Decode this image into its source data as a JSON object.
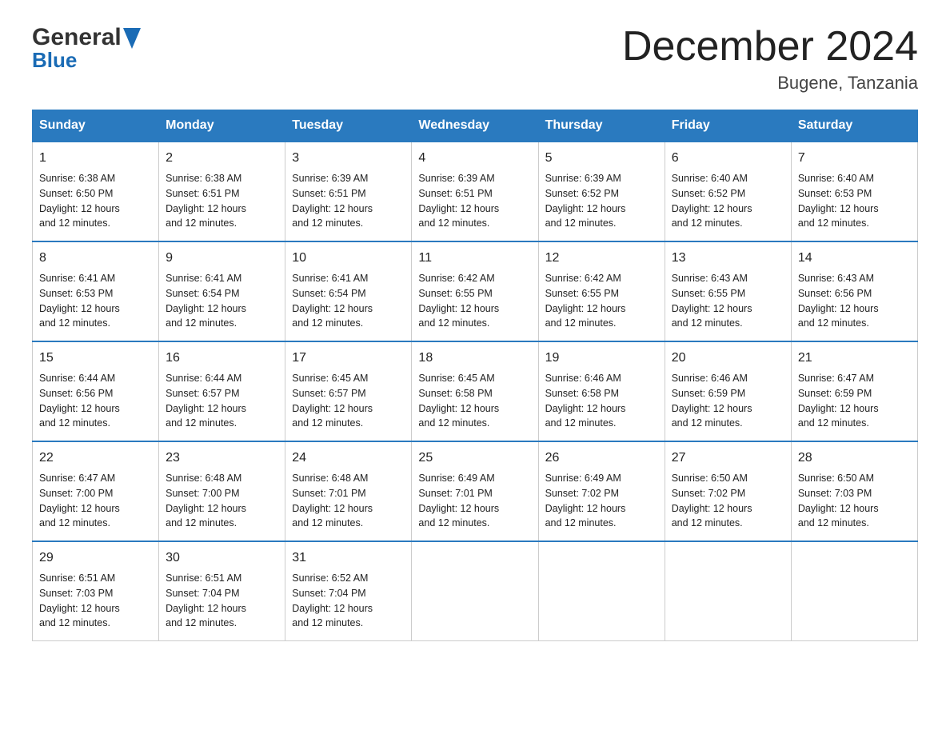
{
  "logo": {
    "general": "General",
    "blue": "Blue",
    "arrow": "▶"
  },
  "header": {
    "month": "December 2024",
    "location": "Bugene, Tanzania"
  },
  "days_of_week": [
    "Sunday",
    "Monday",
    "Tuesday",
    "Wednesday",
    "Thursday",
    "Friday",
    "Saturday"
  ],
  "weeks": [
    [
      {
        "day": 1,
        "sunrise": "6:38 AM",
        "sunset": "6:50 PM",
        "daylight": "12 hours and 12 minutes."
      },
      {
        "day": 2,
        "sunrise": "6:38 AM",
        "sunset": "6:51 PM",
        "daylight": "12 hours and 12 minutes."
      },
      {
        "day": 3,
        "sunrise": "6:39 AM",
        "sunset": "6:51 PM",
        "daylight": "12 hours and 12 minutes."
      },
      {
        "day": 4,
        "sunrise": "6:39 AM",
        "sunset": "6:51 PM",
        "daylight": "12 hours and 12 minutes."
      },
      {
        "day": 5,
        "sunrise": "6:39 AM",
        "sunset": "6:52 PM",
        "daylight": "12 hours and 12 minutes."
      },
      {
        "day": 6,
        "sunrise": "6:40 AM",
        "sunset": "6:52 PM",
        "daylight": "12 hours and 12 minutes."
      },
      {
        "day": 7,
        "sunrise": "6:40 AM",
        "sunset": "6:53 PM",
        "daylight": "12 hours and 12 minutes."
      }
    ],
    [
      {
        "day": 8,
        "sunrise": "6:41 AM",
        "sunset": "6:53 PM",
        "daylight": "12 hours and 12 minutes."
      },
      {
        "day": 9,
        "sunrise": "6:41 AM",
        "sunset": "6:54 PM",
        "daylight": "12 hours and 12 minutes."
      },
      {
        "day": 10,
        "sunrise": "6:41 AM",
        "sunset": "6:54 PM",
        "daylight": "12 hours and 12 minutes."
      },
      {
        "day": 11,
        "sunrise": "6:42 AM",
        "sunset": "6:55 PM",
        "daylight": "12 hours and 12 minutes."
      },
      {
        "day": 12,
        "sunrise": "6:42 AM",
        "sunset": "6:55 PM",
        "daylight": "12 hours and 12 minutes."
      },
      {
        "day": 13,
        "sunrise": "6:43 AM",
        "sunset": "6:55 PM",
        "daylight": "12 hours and 12 minutes."
      },
      {
        "day": 14,
        "sunrise": "6:43 AM",
        "sunset": "6:56 PM",
        "daylight": "12 hours and 12 minutes."
      }
    ],
    [
      {
        "day": 15,
        "sunrise": "6:44 AM",
        "sunset": "6:56 PM",
        "daylight": "12 hours and 12 minutes."
      },
      {
        "day": 16,
        "sunrise": "6:44 AM",
        "sunset": "6:57 PM",
        "daylight": "12 hours and 12 minutes."
      },
      {
        "day": 17,
        "sunrise": "6:45 AM",
        "sunset": "6:57 PM",
        "daylight": "12 hours and 12 minutes."
      },
      {
        "day": 18,
        "sunrise": "6:45 AM",
        "sunset": "6:58 PM",
        "daylight": "12 hours and 12 minutes."
      },
      {
        "day": 19,
        "sunrise": "6:46 AM",
        "sunset": "6:58 PM",
        "daylight": "12 hours and 12 minutes."
      },
      {
        "day": 20,
        "sunrise": "6:46 AM",
        "sunset": "6:59 PM",
        "daylight": "12 hours and 12 minutes."
      },
      {
        "day": 21,
        "sunrise": "6:47 AM",
        "sunset": "6:59 PM",
        "daylight": "12 hours and 12 minutes."
      }
    ],
    [
      {
        "day": 22,
        "sunrise": "6:47 AM",
        "sunset": "7:00 PM",
        "daylight": "12 hours and 12 minutes."
      },
      {
        "day": 23,
        "sunrise": "6:48 AM",
        "sunset": "7:00 PM",
        "daylight": "12 hours and 12 minutes."
      },
      {
        "day": 24,
        "sunrise": "6:48 AM",
        "sunset": "7:01 PM",
        "daylight": "12 hours and 12 minutes."
      },
      {
        "day": 25,
        "sunrise": "6:49 AM",
        "sunset": "7:01 PM",
        "daylight": "12 hours and 12 minutes."
      },
      {
        "day": 26,
        "sunrise": "6:49 AM",
        "sunset": "7:02 PM",
        "daylight": "12 hours and 12 minutes."
      },
      {
        "day": 27,
        "sunrise": "6:50 AM",
        "sunset": "7:02 PM",
        "daylight": "12 hours and 12 minutes."
      },
      {
        "day": 28,
        "sunrise": "6:50 AM",
        "sunset": "7:03 PM",
        "daylight": "12 hours and 12 minutes."
      }
    ],
    [
      {
        "day": 29,
        "sunrise": "6:51 AM",
        "sunset": "7:03 PM",
        "daylight": "12 hours and 12 minutes."
      },
      {
        "day": 30,
        "sunrise": "6:51 AM",
        "sunset": "7:04 PM",
        "daylight": "12 hours and 12 minutes."
      },
      {
        "day": 31,
        "sunrise": "6:52 AM",
        "sunset": "7:04 PM",
        "daylight": "12 hours and 12 minutes."
      },
      null,
      null,
      null,
      null
    ]
  ]
}
